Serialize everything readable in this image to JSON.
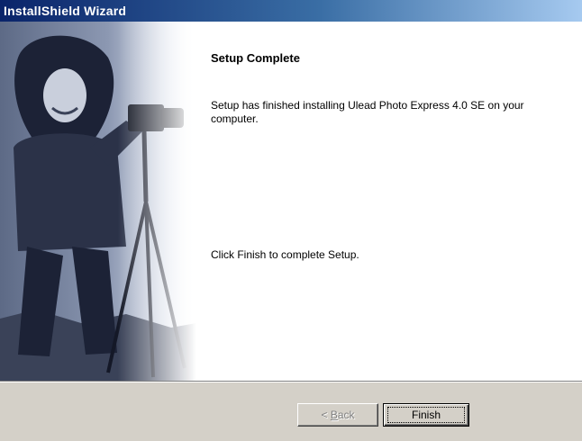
{
  "window": {
    "title": "InstallShield Wizard"
  },
  "main": {
    "heading": "Setup Complete",
    "message": "Setup has finished installing Ulead Photo Express 4.0 SE on your computer.",
    "instruction": "Click Finish to complete Setup."
  },
  "buttons": {
    "back_prefix": "< ",
    "back_accel": "B",
    "back_rest": "ack",
    "finish_label": "Finish"
  },
  "colors": {
    "titlebar_start": "#0a246a",
    "titlebar_end": "#a6caf0",
    "dialog_face": "#d4d0c8",
    "content_bg": "#ffffff"
  }
}
